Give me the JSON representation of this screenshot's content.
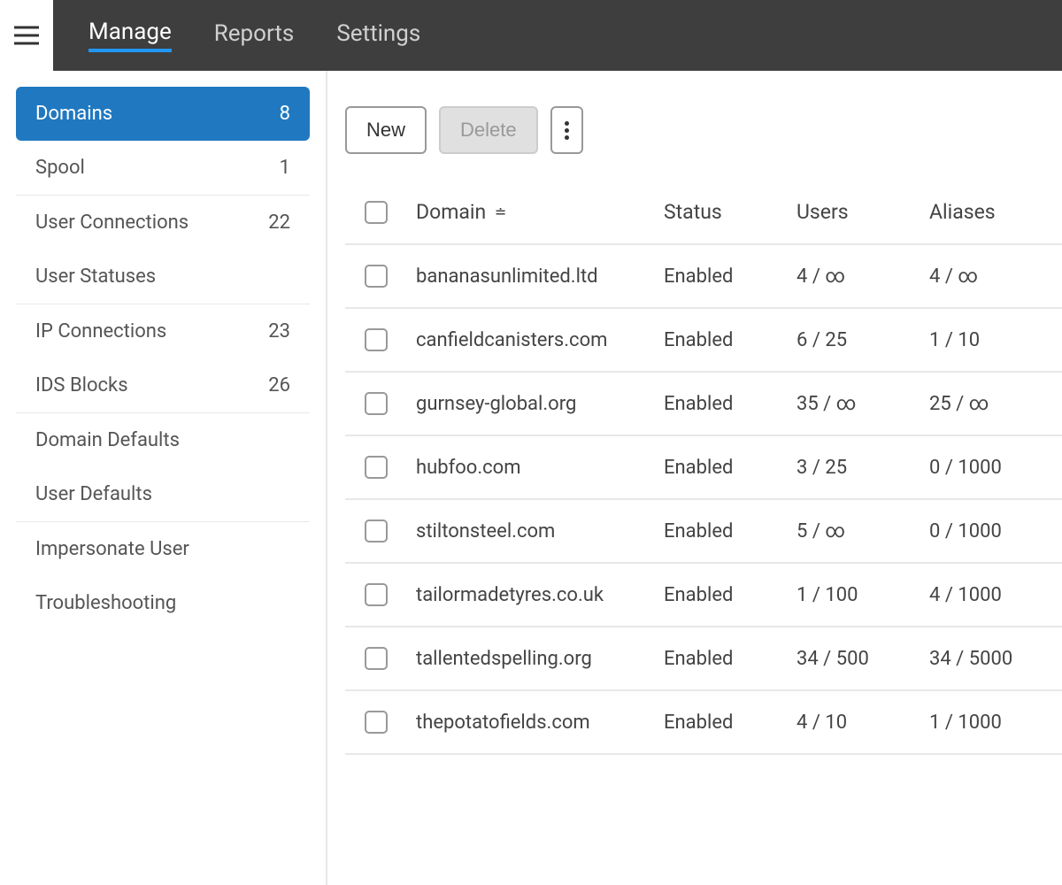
{
  "topnav": {
    "tabs": [
      {
        "label": "Manage",
        "active": true
      },
      {
        "label": "Reports",
        "active": false
      },
      {
        "label": "Settings",
        "active": false
      }
    ]
  },
  "sidebar": {
    "items": [
      {
        "label": "Domains",
        "count": "8",
        "active": true,
        "border": true
      },
      {
        "label": "Spool",
        "count": "1",
        "active": false,
        "border": true
      },
      {
        "label": "User Connections",
        "count": "22",
        "active": false,
        "border": false
      },
      {
        "label": "User Statuses",
        "count": "",
        "active": false,
        "border": true
      },
      {
        "label": "IP Connections",
        "count": "23",
        "active": false,
        "border": false
      },
      {
        "label": "IDS Blocks",
        "count": "26",
        "active": false,
        "border": true
      },
      {
        "label": "Domain Defaults",
        "count": "",
        "active": false,
        "border": false
      },
      {
        "label": "User Defaults",
        "count": "",
        "active": false,
        "border": true
      },
      {
        "label": "Impersonate User",
        "count": "",
        "active": false,
        "border": false
      },
      {
        "label": "Troubleshooting",
        "count": "",
        "active": false,
        "border": false
      }
    ]
  },
  "toolbar": {
    "new_label": "New",
    "delete_label": "Delete"
  },
  "table": {
    "headers": {
      "domain": "Domain",
      "status": "Status",
      "users": "Users",
      "aliases": "Aliases"
    },
    "sort_indicator": "≐",
    "rows": [
      {
        "domain": "bananasunlimited.ltd",
        "status": "Enabled",
        "users": "4 / ∞",
        "aliases": "4 / ∞"
      },
      {
        "domain": "canfieldcanisters.com",
        "status": "Enabled",
        "users": "6 / 25",
        "aliases": "1 / 10"
      },
      {
        "domain": "gurnsey-global.org",
        "status": "Enabled",
        "users": "35 / ∞",
        "aliases": "25 / ∞"
      },
      {
        "domain": "hubfoo.com",
        "status": "Enabled",
        "users": "3 / 25",
        "aliases": "0 / 1000"
      },
      {
        "domain": "stiltonsteel.com",
        "status": "Enabled",
        "users": "5 / ∞",
        "aliases": "0 / 1000"
      },
      {
        "domain": "tailormadetyres.co.uk",
        "status": "Enabled",
        "users": "1 / 100",
        "aliases": "4 / 1000"
      },
      {
        "domain": "tallentedspelling.org",
        "status": "Enabled",
        "users": "34 / 500",
        "aliases": "34 / 5000"
      },
      {
        "domain": "thepotatofields.com",
        "status": "Enabled",
        "users": "4 / 10",
        "aliases": "1 / 1000"
      }
    ]
  }
}
